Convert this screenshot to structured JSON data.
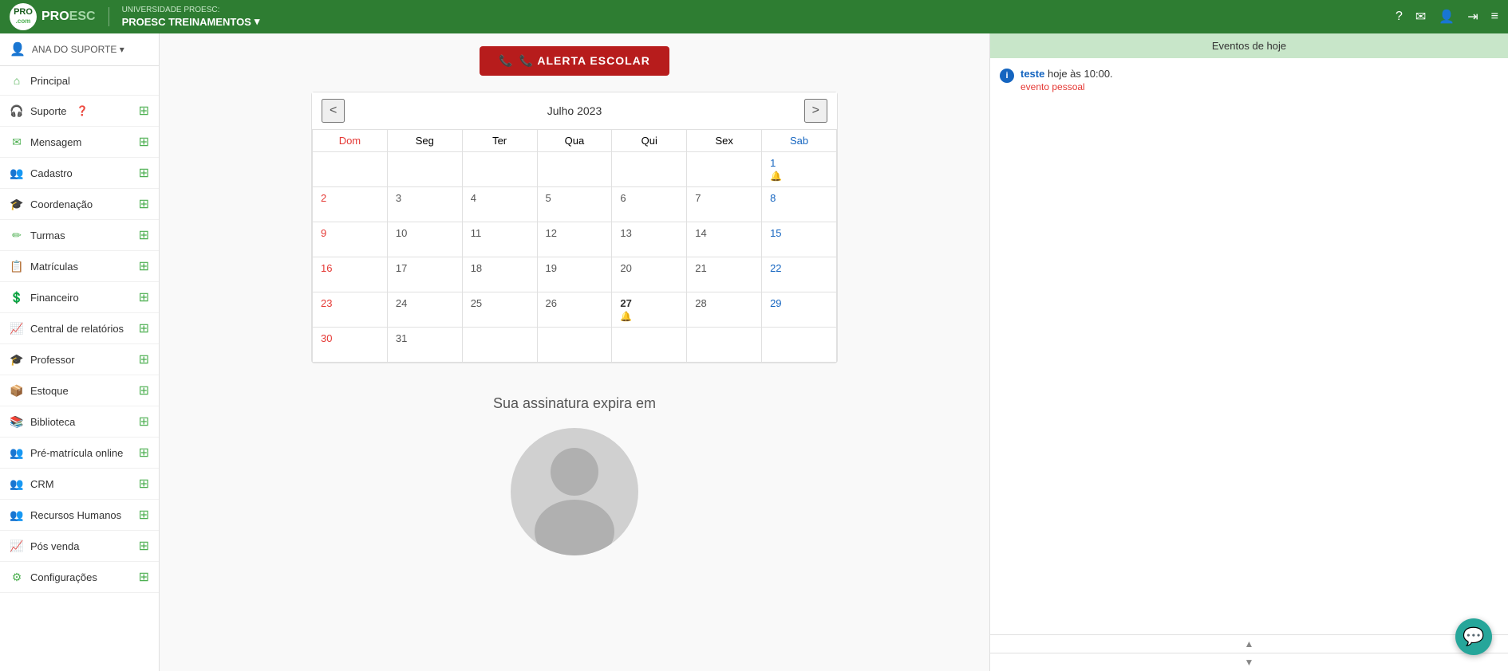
{
  "topbar": {
    "uni_label": "UNIVERSIDADE PROESC:",
    "brand": "PROESC TREINAMENTOS",
    "brand_arrow": "▾",
    "logo_text": "PRO",
    "logo_com": ".com",
    "icons": {
      "help": "?",
      "mail": "✉",
      "user": "👤",
      "exit": "⇥",
      "menu": "≡"
    }
  },
  "sidebar": {
    "user_name": "ANA DO SUPORTE ▾",
    "items": [
      {
        "id": "principal",
        "label": "Principal",
        "icon": "🏠",
        "has_plus": false
      },
      {
        "id": "suporte",
        "label": "Suporte",
        "icon": "🎧",
        "has_plus": true,
        "has_help": true
      },
      {
        "id": "mensagem",
        "label": "Mensagem",
        "icon": "✉",
        "has_plus": true
      },
      {
        "id": "cadastro",
        "label": "Cadastro",
        "icon": "👥",
        "has_plus": true
      },
      {
        "id": "coordenacao",
        "label": "Coordenação",
        "icon": "🎓",
        "has_plus": true
      },
      {
        "id": "turmas",
        "label": "Turmas",
        "icon": "✏",
        "has_plus": true
      },
      {
        "id": "matriculas",
        "label": "Matrículas",
        "icon": "📋",
        "has_plus": true
      },
      {
        "id": "financeiro",
        "label": "Financeiro",
        "icon": "💲",
        "has_plus": true
      },
      {
        "id": "relatorios",
        "label": "Central de relatórios",
        "icon": "📈",
        "has_plus": true
      },
      {
        "id": "professor",
        "label": "Professor",
        "icon": "🎓",
        "has_plus": true
      },
      {
        "id": "estoque",
        "label": "Estoque",
        "icon": "📦",
        "has_plus": true
      },
      {
        "id": "biblioteca",
        "label": "Biblioteca",
        "icon": "📚",
        "has_plus": true
      },
      {
        "id": "pre-matricula",
        "label": "Pré-matrícula online",
        "icon": "👥",
        "has_plus": true
      },
      {
        "id": "crm",
        "label": "CRM",
        "icon": "👥",
        "has_plus": true
      },
      {
        "id": "rh",
        "label": "Recursos Humanos",
        "icon": "👥",
        "has_plus": true
      },
      {
        "id": "pos-venda",
        "label": "Pós venda",
        "icon": "📈",
        "has_plus": true
      },
      {
        "id": "configuracoes",
        "label": "Configurações",
        "icon": "⚙",
        "has_plus": true
      }
    ]
  },
  "calendar": {
    "prev": "<",
    "next": ">",
    "title": "Julho 2023",
    "days": [
      "Dom",
      "Seg",
      "Ter",
      "Qua",
      "Qui",
      "Sex",
      "Sab"
    ],
    "weeks": [
      [
        "",
        "",
        "",
        "",
        "",
        "",
        "1"
      ],
      [
        "2",
        "3",
        "4",
        "5",
        "6",
        "7",
        "8"
      ],
      [
        "9",
        "10",
        "11",
        "12",
        "13",
        "14",
        "15"
      ],
      [
        "16",
        "17",
        "18",
        "19",
        "20",
        "21",
        "22"
      ],
      [
        "23",
        "24",
        "25",
        "26",
        "27",
        "28",
        "29"
      ],
      [
        "30",
        "31",
        "",
        "",
        "",
        "",
        ""
      ]
    ],
    "bell_days": [
      "1",
      "27"
    ]
  },
  "alert": {
    "label": "📞 ALERTA ESCOLAR"
  },
  "subscription": {
    "text": "Sua assinatura expira em"
  },
  "events": {
    "header": "Eventos de hoje",
    "items": [
      {
        "icon": "i",
        "name": "teste",
        "time": "hoje às 10:00.",
        "tag": "evento pessoal"
      }
    ]
  },
  "chat": {
    "icon": "💬"
  }
}
